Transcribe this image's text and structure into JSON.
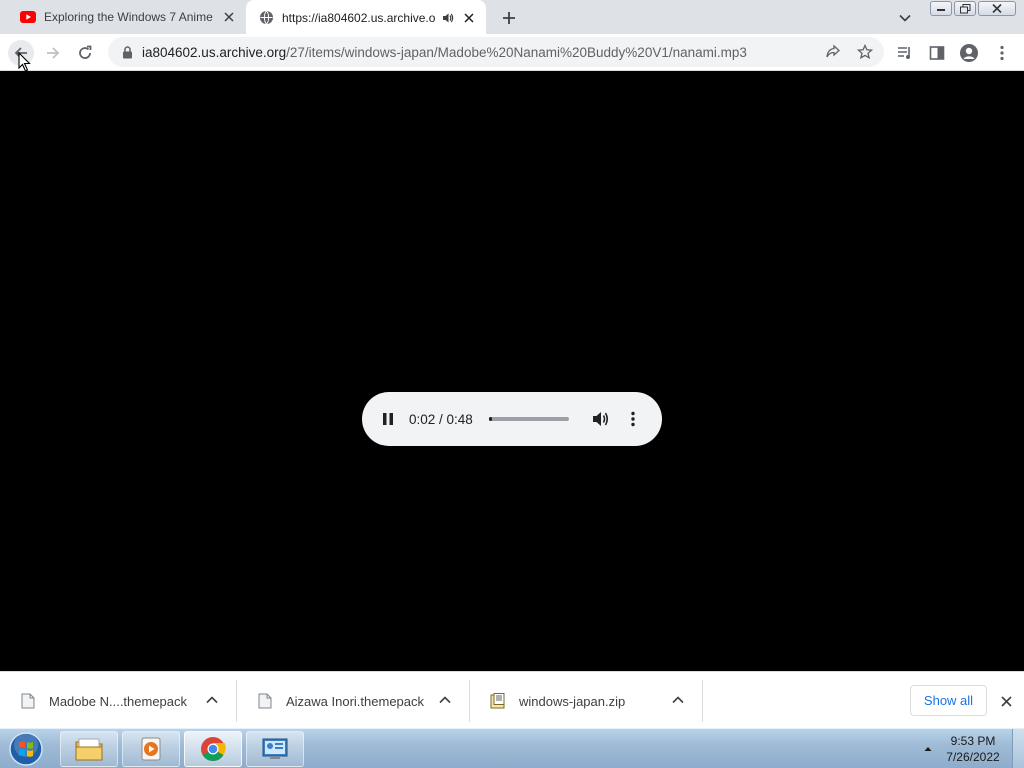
{
  "tabs": [
    {
      "title": "Exploring the Windows 7 Anime",
      "favicon": "youtube-icon",
      "active": false
    },
    {
      "title": "https://ia804602.us.archive.o",
      "favicon": "globe-icon",
      "active": true,
      "audio": "speaker-icon"
    }
  ],
  "toolbar": {
    "url_host": "ia804602.us.archive.org",
    "url_path": "/27/items/windows-japan/Madobe%20Nanami%20Buddy%20V1/nanami.mp3"
  },
  "player": {
    "state": "playing",
    "time": "0:02 / 0:48",
    "progress": 0.042
  },
  "downloads": [
    {
      "name": "Madobe N....themepack",
      "icon": "file-icon"
    },
    {
      "name": "Aizawa Inori.themepack",
      "icon": "file-icon"
    },
    {
      "name": "windows-japan.zip",
      "icon": "zip-icon"
    }
  ],
  "shelf": {
    "show_all": "Show all"
  },
  "taskbar": {
    "time": "9:53 PM",
    "date": "7/26/2022",
    "apps": [
      "explorer-icon",
      "media-player-icon",
      "chrome-icon",
      "control-panel-icon"
    ]
  },
  "colors": {
    "accent": "#1a73e8",
    "content_bg": "#000000",
    "tabstrip": "#dee1e6"
  }
}
